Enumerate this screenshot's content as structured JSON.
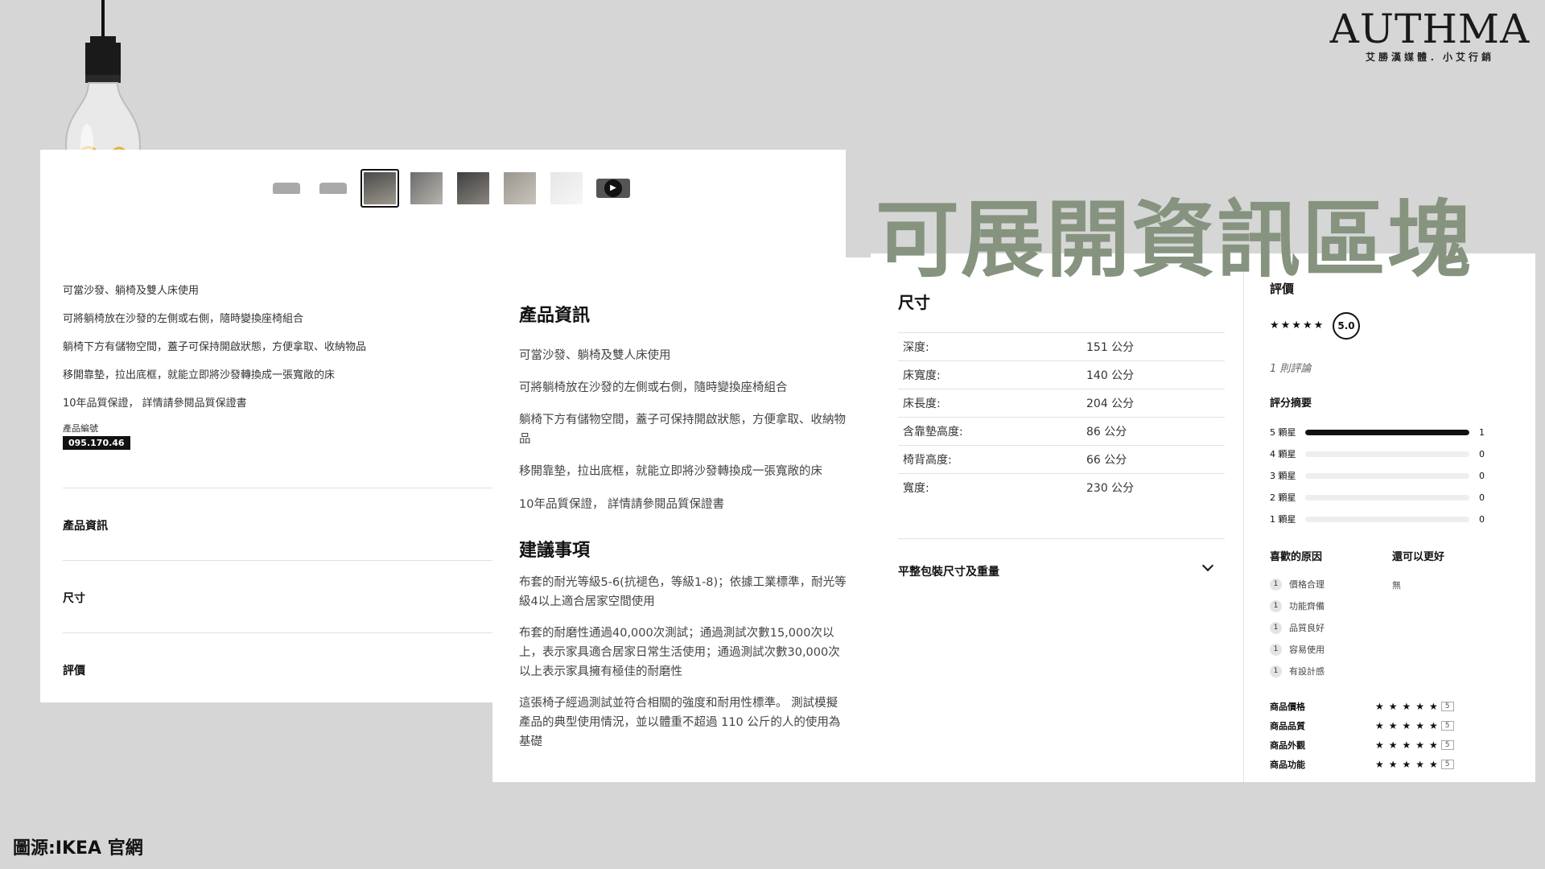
{
  "brand": {
    "name": "AUTHMA",
    "subtitle": "艾勝漢媒體．小艾行銷"
  },
  "overlay_title": "可展開資訊區塊",
  "source": "圖源:IKEA  官網",
  "product": {
    "bullets": [
      "可當沙發、躺椅及雙人床使用",
      "可將躺椅放在沙發的左側或右側，隨時變換座椅組合",
      "躺椅下方有儲物空間，蓋子可保持開啟狀態，方便拿取、收納物品",
      "移開靠墊，拉出底框，就能立即將沙發轉換成一張寬敞的床",
      "10年品質保證， 詳情請參閱品質保證書"
    ],
    "article_label": "產品編號",
    "article_number": "095.170.46",
    "accordion": [
      "產品資訊",
      "尺寸",
      "評價"
    ]
  },
  "info": {
    "title": "產品資訊",
    "lines": [
      "可當沙發、躺椅及雙人床使用",
      "可將躺椅放在沙發的左側或右側，隨時變換座椅組合",
      "躺椅下方有儲物空間，蓋子可保持開啟狀態，方便拿取、收納物品",
      "移開靠墊，拉出底框，就能立即將沙發轉換成一張寬敞的床",
      "10年品質保證， 詳情請參閱品質保證書"
    ],
    "advice_title": "建議事項",
    "advice": [
      "布套的耐光等級5-6(抗褪色，等級1-8)；依據工業標準，耐光等級4以上適合居家空間使用",
      "布套的耐磨性通過40,000次測試；通過測試次數15,000次以上，表示家具適合居家日常生活使用；通過測試次數30,000次以上表示家具擁有極佳的耐磨性",
      "這張椅子經過測試並符合相關的強度和耐用性標準。 測試模擬產品的典型使用情況，並以體重不超過 110 公斤的人的使用為基礎"
    ]
  },
  "dimensions": {
    "title": "尺寸",
    "rows": [
      {
        "label": "深度:",
        "value": "151 公分"
      },
      {
        "label": "床寬度:",
        "value": "140 公分"
      },
      {
        "label": "床長度:",
        "value": "204 公分"
      },
      {
        "label": "含靠墊高度:",
        "value": "86 公分"
      },
      {
        "label": "椅背高度:",
        "value": "66 公分"
      },
      {
        "label": "寬度:",
        "value": "230 公分"
      }
    ],
    "package_label": "平整包裝尺寸及重量"
  },
  "reviews": {
    "title": "評價",
    "stars": "★★★★★",
    "score": "5.0",
    "count": "1 則評論",
    "summary_title": "評分摘要",
    "breakdown": [
      {
        "label": "5 顆星",
        "count": "1",
        "fraction": 1.0
      },
      {
        "label": "4 顆星",
        "count": "0",
        "fraction": 0
      },
      {
        "label": "3 顆星",
        "count": "0",
        "fraction": 0
      },
      {
        "label": "2 顆星",
        "count": "0",
        "fraction": 0
      },
      {
        "label": "1 顆星",
        "count": "0",
        "fraction": 0
      }
    ],
    "likes_title": "喜歡的原因",
    "improve_title": "還可以更好",
    "likes": [
      {
        "n": "1",
        "label": "價格合理"
      },
      {
        "n": "1",
        "label": "功能齊備"
      },
      {
        "n": "1",
        "label": "品質良好"
      },
      {
        "n": "1",
        "label": "容易使用"
      },
      {
        "n": "1",
        "label": "有設計感"
      }
    ],
    "improve_none": "無",
    "categories": [
      {
        "label": "商品價格",
        "stars": "★★★★★",
        "score": "5"
      },
      {
        "label": "商品品質",
        "stars": "★★★★★",
        "score": "5"
      },
      {
        "label": "商品外觀",
        "stars": "★★★★★",
        "score": "5"
      },
      {
        "label": "商品功能",
        "stars": "★★★★★",
        "score": "5"
      }
    ]
  }
}
